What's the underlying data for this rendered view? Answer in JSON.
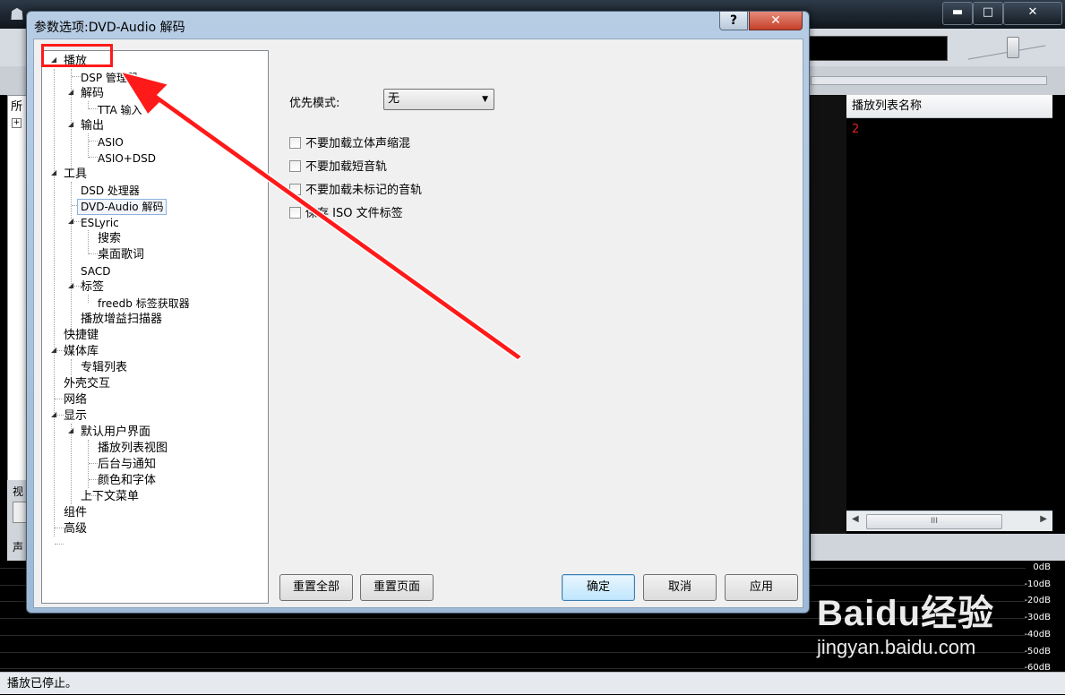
{
  "dialog": {
    "title": "参数选项:DVD-Audio 解码",
    "help_label": "?",
    "close_label": "✕"
  },
  "tree": [
    {
      "label": "播放",
      "expanded": true
    },
    {
      "label": "DSP 管理器"
    },
    {
      "label": "解码",
      "expanded": true
    },
    {
      "label": "TTA 输入"
    },
    {
      "label": "输出",
      "expanded": true
    },
    {
      "label": "ASIO"
    },
    {
      "label": "ASIO+DSD"
    },
    {
      "label": "工具",
      "expanded": true
    },
    {
      "label": "DSD 处理器"
    },
    {
      "label": "DVD-Audio 解码",
      "selected": true
    },
    {
      "label": "ESLyric",
      "expanded": true
    },
    {
      "label": "搜索"
    },
    {
      "label": "桌面歌词"
    },
    {
      "label": "SACD"
    },
    {
      "label": "标签",
      "expanded": true
    },
    {
      "label": "freedb 标签获取器"
    },
    {
      "label": "播放增益扫描器"
    },
    {
      "label": "快捷键"
    },
    {
      "label": "媒体库",
      "expanded": true
    },
    {
      "label": "专辑列表"
    },
    {
      "label": "外壳交互"
    },
    {
      "label": "网络"
    },
    {
      "label": "显示",
      "expanded": true
    },
    {
      "label": "默认用户界面",
      "expanded": true
    },
    {
      "label": "播放列表视图"
    },
    {
      "label": "后台与通知"
    },
    {
      "label": "颜色和字体"
    },
    {
      "label": "上下文菜单"
    },
    {
      "label": "组件"
    },
    {
      "label": "高级"
    }
  ],
  "page": {
    "priority_label": "优先模式:",
    "priority_value": "无",
    "checkboxes": [
      {
        "label": "不要加载立体声缩混",
        "checked": false
      },
      {
        "label": "不要加载短音轨",
        "checked": false
      },
      {
        "label": "不要加载未标记的音轨",
        "checked": false
      },
      {
        "label": "保存 ISO 文件标签",
        "checked": false
      }
    ]
  },
  "buttons": {
    "reset_all": "重置全部",
    "reset_page": "重置页面",
    "ok": "确定",
    "cancel": "取消",
    "apply": "应用"
  },
  "background": {
    "window_min": "▬",
    "window_max": "□",
    "window_close": "✕",
    "left_tab": "所",
    "left_plus": "+",
    "left_lower_a": "视",
    "left_lower_c": "声",
    "playlist_header": "播放列表名称",
    "playlist_row": "2",
    "scroll_grip": "III",
    "db_scale": [
      "0dB",
      "-10dB",
      "-20dB",
      "-30dB",
      "-40dB",
      "-50dB",
      "-60dB"
    ],
    "status": "播放已停止。",
    "watermark_brand": "Baidu经验",
    "watermark_url": "jingyan.baidu.com"
  },
  "annotation_color": "#ff1a1a"
}
